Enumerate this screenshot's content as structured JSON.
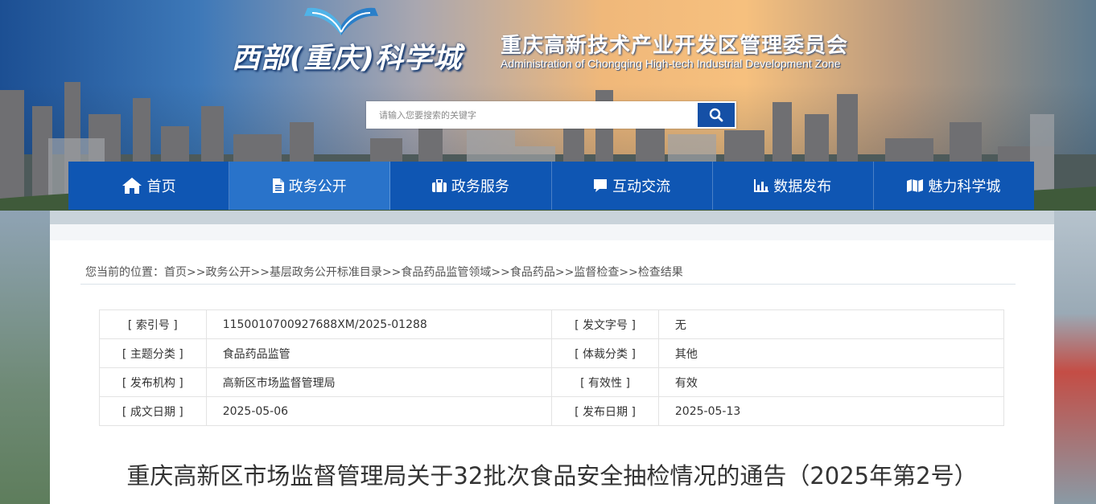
{
  "header": {
    "logo_text": "西部(重庆)科学城",
    "agency_cn": "重庆高新技术产业开发区管理委员会",
    "agency_en": "Administration of Chongqing High-tech Industrial Development Zone"
  },
  "search": {
    "placeholder": "请输入您要搜索的关键字",
    "button_icon": "search-icon"
  },
  "nav": {
    "items": [
      {
        "label": "首页",
        "icon": "home-icon"
      },
      {
        "label": "政务公开",
        "icon": "document-icon"
      },
      {
        "label": "政务服务",
        "icon": "briefcase-icon"
      },
      {
        "label": "互动交流",
        "icon": "chat-icon"
      },
      {
        "label": "数据发布",
        "icon": "bar-chart-icon"
      },
      {
        "label": "魅力科学城",
        "icon": "map-icon"
      }
    ],
    "active_index": 1
  },
  "breadcrumb": {
    "prefix": "您当前的位置：",
    "items": [
      "首页",
      "政务公开",
      "基层政务公开标准目录",
      "食品药品监管领域",
      "食品药品",
      "监督检查",
      "检查结果"
    ],
    "separator": ">>"
  },
  "meta": {
    "rows": [
      {
        "k1": "[ 索引号 ]",
        "v1": "1150010700927688XM/2025-01288",
        "k2": "[ 发文字号 ]",
        "v2": "无"
      },
      {
        "k1": "[ 主题分类 ]",
        "v1": "食品药品监管",
        "k2": "[ 体裁分类 ]",
        "v2": "其他"
      },
      {
        "k1": "[ 发布机构 ]",
        "v1": "高新区市场监督管理局",
        "k2": "[ 有效性 ]",
        "v2": "有效"
      },
      {
        "k1": "[ 成文日期 ]",
        "v1": "2025-05-06",
        "k2": "[ 发布日期 ]",
        "v2": "2025-05-13"
      }
    ]
  },
  "article": {
    "title": "重庆高新区市场监督管理局关于32批次食品安全抽检情况的通告（2025年第2号）"
  },
  "colors": {
    "nav_bg": "#0f56b3",
    "search_button": "#1550a6",
    "text": "#333333"
  }
}
